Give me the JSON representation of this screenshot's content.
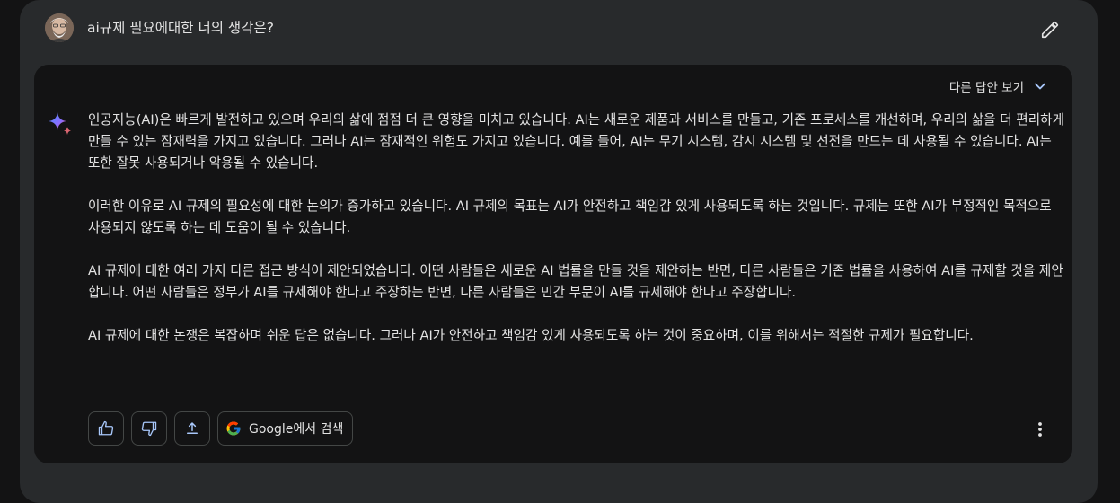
{
  "prompt": {
    "text": "ai규제 필요에대한 너의 생각은?"
  },
  "drafts": {
    "label": "다른 답안 보기"
  },
  "response": {
    "paragraphs": [
      "인공지능(AI)은 빠르게 발전하고 있으며 우리의 삶에 점점 더 큰 영향을 미치고 있습니다. AI는 새로운 제품과 서비스를 만들고, 기존 프로세스를 개선하며, 우리의 삶을 더 편리하게 만들 수 있는 잠재력을 가지고 있습니다. 그러나 AI는 잠재적인 위험도 가지고 있습니다. 예를 들어, AI는 무기 시스템, 감시 시스템 및 선전을 만드는 데 사용될 수 있습니다. AI는 또한 잘못 사용되거나 악용될 수 있습니다.",
      "이러한 이유로 AI 규제의 필요성에 대한 논의가 증가하고 있습니다. AI 규제의 목표는 AI가 안전하고 책임감 있게 사용되도록 하는 것입니다. 규제는 또한 AI가 부정적인 목적으로 사용되지 않도록 하는 데 도움이 될 수 있습니다.",
      "AI 규제에 대한 여러 가지 다른 접근 방식이 제안되었습니다. 어떤 사람들은 새로운 AI 법률을 만들 것을 제안하는 반면, 다른 사람들은 기존 법률을 사용하여 AI를 규제할 것을 제안합니다. 어떤 사람들은 정부가 AI를 규제해야 한다고 주장하는 반면, 다른 사람들은 민간 부문이 AI를 규제해야 한다고 주장합니다.",
      "AI 규제에 대한 논쟁은 복잡하며 쉬운 답은 없습니다. 그러나 AI가 안전하고 책임감 있게 사용되도록 하는 것이 중요하며, 이를 위해서는 적절한 규제가 필요합니다."
    ]
  },
  "actions": {
    "google_label": "Google에서 검색"
  },
  "colors": {
    "page_bg": "#131314",
    "prompt_bg": "#282a2c",
    "text": "#e3e3e3",
    "border": "#444746",
    "spark_blue": "#4b90ff",
    "spark_red": "#ff5546"
  }
}
